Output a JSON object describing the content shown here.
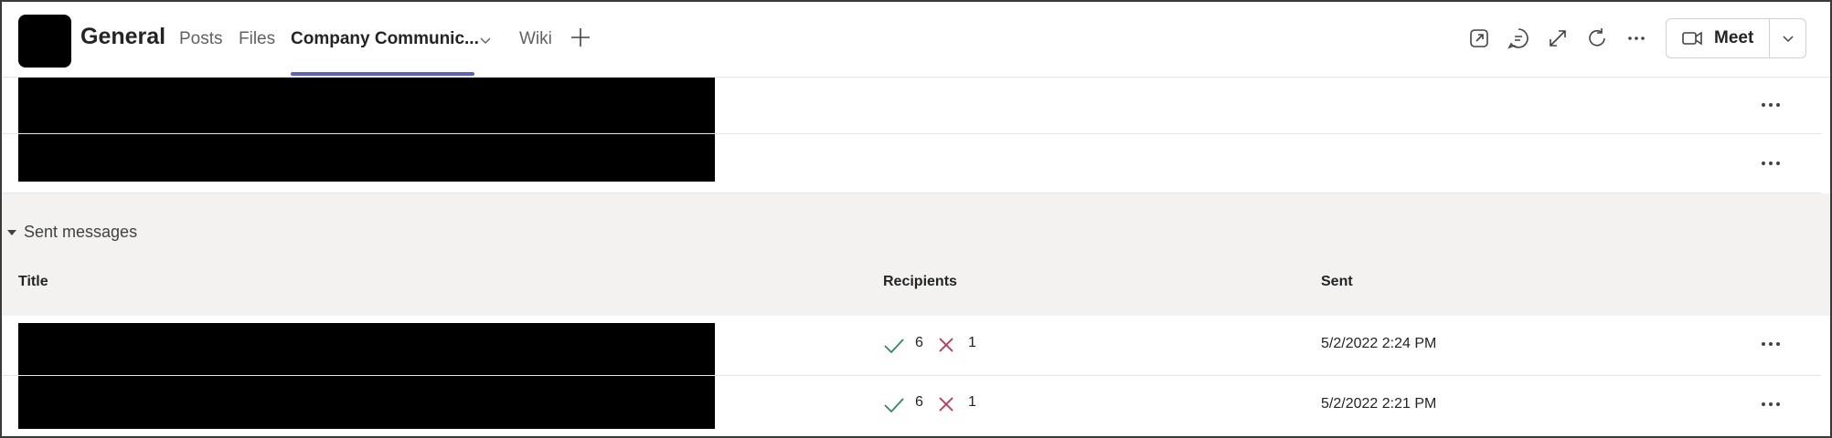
{
  "header": {
    "channel_name": "General",
    "tabs": [
      {
        "label": "Posts",
        "active": false
      },
      {
        "label": "Files",
        "active": false
      },
      {
        "label": "Company Communic...",
        "active": true
      },
      {
        "label": "Wiki",
        "active": false
      }
    ],
    "icons": [
      "popout-icon",
      "chat-icon",
      "expand-icon",
      "refresh-icon",
      "more-icon"
    ],
    "meet_label": "Meet",
    "accent": "#5b5fc7"
  },
  "sent_messages": {
    "section_label": "Sent messages",
    "columns": {
      "title": "Title",
      "recipients": "Recipients",
      "sent": "Sent"
    },
    "rows": [
      {
        "success": "6",
        "failed": "1",
        "sent": "5/2/2022 2:24 PM"
      },
      {
        "success": "6",
        "failed": "1",
        "sent": "5/2/2022 2:21 PM"
      }
    ]
  },
  "colors": {
    "success": "#2e8b57",
    "failed": "#c4314b"
  }
}
